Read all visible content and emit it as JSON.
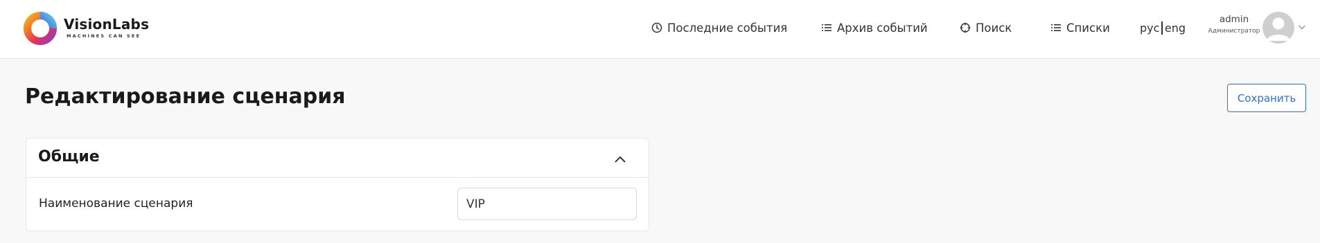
{
  "brand": {
    "name": "VisionLabs",
    "tagline": "MACHINES CAN SEE",
    "colors": [
      "#e8305b",
      "#f26a2d",
      "#f5b51d",
      "#5fc3e8",
      "#3b5fd9",
      "#8a3fc2"
    ]
  },
  "nav": [
    {
      "label": "Последние события",
      "icon": "clock-icon"
    },
    {
      "label": "Архив событий",
      "icon": "list-icon"
    },
    {
      "label": "Поиск",
      "icon": "crosshair-icon"
    },
    {
      "label": "Списки",
      "icon": "list-icon"
    }
  ],
  "language": {
    "ru": "рус",
    "en": "eng"
  },
  "user": {
    "name": "admin",
    "role": "Администратор",
    "avatar_icon": "user-avatar-icon",
    "menu_icon": "chevron-down-icon"
  },
  "page": {
    "title": "Редактирование сценария",
    "save_label": "Сохранить"
  },
  "section": {
    "title": "Общие",
    "toggle_icon": "chevron-up-icon",
    "fields": [
      {
        "label": "Наименование сценария",
        "value": "VIP"
      }
    ]
  },
  "colors": {
    "accent": "#2f6fd9",
    "background": "#f8f8f8",
    "header_bg": "#ffffff"
  }
}
